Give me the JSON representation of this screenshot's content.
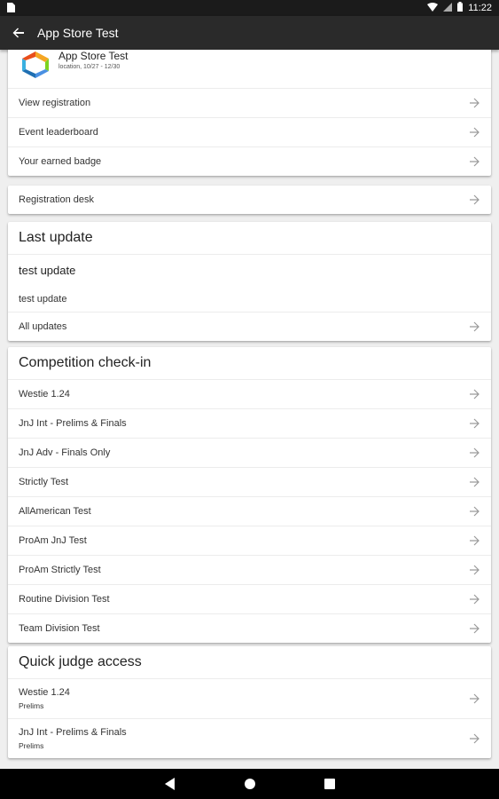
{
  "status_bar": {
    "time": "11:22"
  },
  "app_bar": {
    "title": "App Store Test"
  },
  "event": {
    "name": "App Store Test",
    "subtitle": "location, 10/27 - 12/30",
    "links": [
      "View registration",
      "Event leaderboard",
      "Your earned badge"
    ]
  },
  "registration": {
    "label": "Registration desk"
  },
  "last_update": {
    "heading": "Last update",
    "title": "test update",
    "body": "test update",
    "all_label": "All updates"
  },
  "competition": {
    "heading": "Competition check-in",
    "items": [
      "Westie 1.24",
      "JnJ Int - Prelims & Finals",
      "JnJ Adv - Finals Only",
      "Strictly Test",
      "AllAmerican Test",
      "ProAm JnJ Test",
      "ProAm Strictly Test",
      "Routine Division Test",
      "Team Division Test"
    ]
  },
  "judge": {
    "heading": "Quick judge access",
    "items": [
      {
        "name": "Westie 1.24",
        "round": "Prelims"
      },
      {
        "name": "JnJ Int - Prelims & Finals",
        "round": "Prelims"
      }
    ]
  },
  "colors": {
    "appbar": "#2a2a2a",
    "statusbar": "#1b1b1b",
    "background": "#efefef"
  },
  "icons": [
    "back-arrow-icon",
    "arrow-right-icon",
    "wifi-icon",
    "signal-icon",
    "battery-icon",
    "sim-icon",
    "nav-back-icon",
    "nav-home-icon",
    "nav-recents-icon"
  ]
}
